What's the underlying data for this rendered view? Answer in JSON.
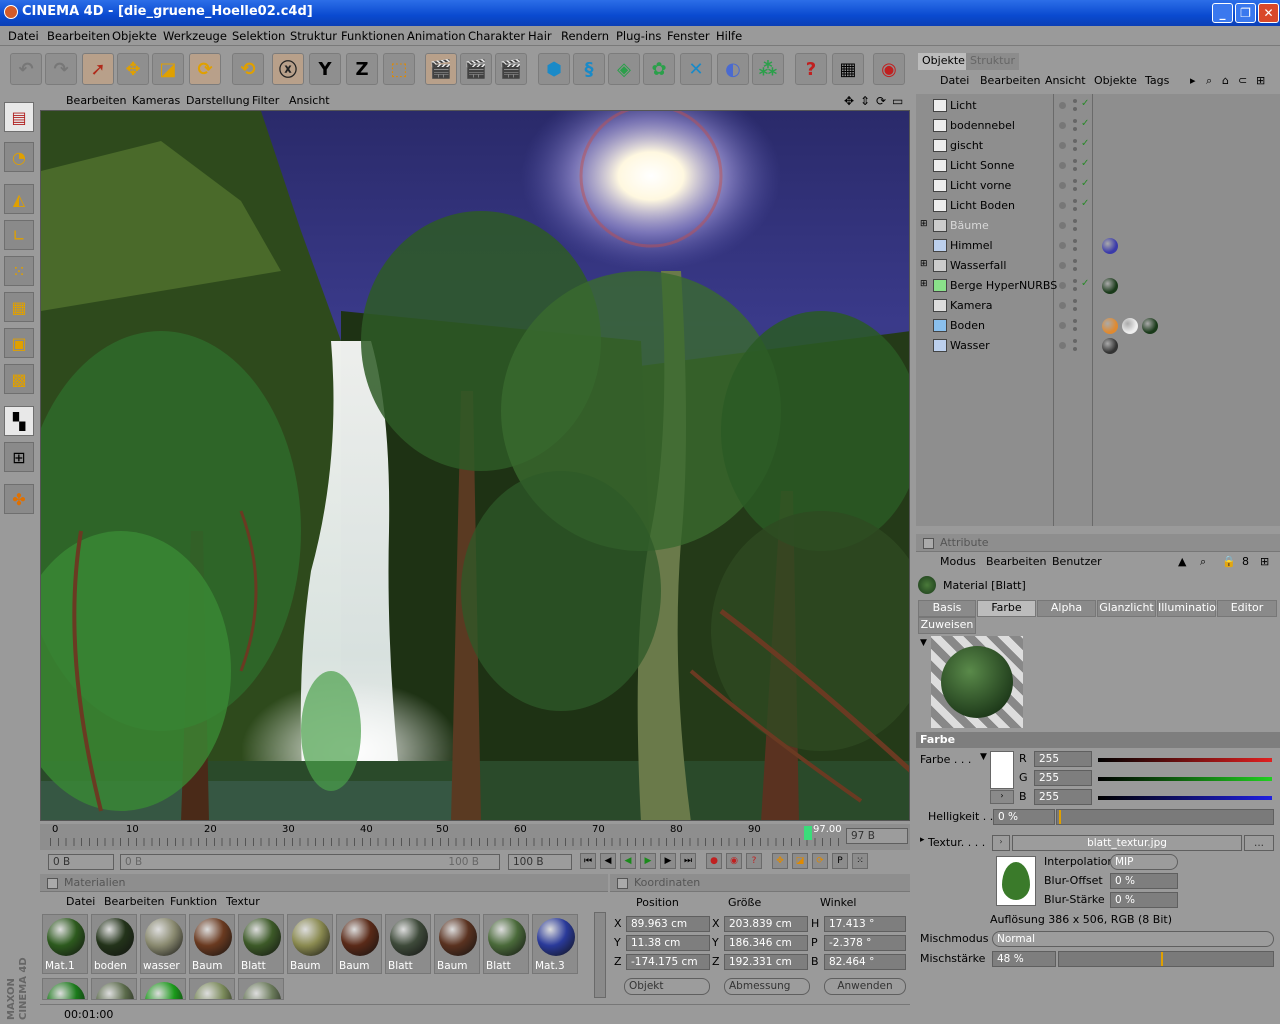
{
  "window": {
    "title": "CINEMA 4D - [die_gruene_Hoelle02.c4d]",
    "min": "_",
    "max": "❐",
    "close": "✕"
  },
  "menubar": [
    "Datei",
    "Bearbeiten",
    "Objekte",
    "Werkzeuge",
    "Selektion",
    "Struktur",
    "Funktionen",
    "Animation",
    "Charakter",
    "Hair",
    "Rendern",
    "Plug-ins",
    "Fenster",
    "Hilfe"
  ],
  "viewport_menu": [
    "Bearbeiten",
    "Kameras",
    "Darstellung",
    "Filter",
    "Ansicht"
  ],
  "timeline": {
    "ticks": [
      "0",
      "10",
      "20",
      "30",
      "40",
      "50",
      "60",
      "70",
      "80",
      "90"
    ],
    "current_marker": "97.00",
    "end_field": "97 B"
  },
  "animbar": {
    "start": "0 B",
    "range_start": "0 B",
    "range_end": "100 B",
    "end": "100 B"
  },
  "materials": {
    "header": "Materialien",
    "menu": [
      "Datei",
      "Bearbeiten",
      "Funktion",
      "Textur"
    ],
    "items": [
      {
        "label": "Mat.1",
        "color": "#2d5a1e"
      },
      {
        "label": "boden",
        "color": "#23331a"
      },
      {
        "label": "wasser",
        "color": "#8a8a70"
      },
      {
        "label": "Baum",
        "color": "#6a3a20"
      },
      {
        "label": "Blatt",
        "color": "#3d5a28"
      },
      {
        "label": "Baum",
        "color": "#8a8a50"
      },
      {
        "label": "Baum",
        "color": "#5a2a18"
      },
      {
        "label": "Blatt",
        "color": "#3e4a3a"
      },
      {
        "label": "Baum",
        "color": "#5a3220"
      },
      {
        "label": "Blatt",
        "color": "#4a6a3a"
      },
      {
        "label": "Mat.3",
        "color": "#2a3a9a"
      }
    ],
    "row2": [
      "#1a7a1a",
      "#5a6a4a",
      "#1a9a1a",
      "#7a8a5a",
      "#6a7a5a"
    ]
  },
  "status": {
    "time": "00:01:00"
  },
  "logo": "MAXON CINEMA 4D",
  "coords": {
    "header": "Koordinaten",
    "cols": [
      "Position",
      "Größe",
      "Winkel"
    ],
    "rows": [
      {
        "a": "X",
        "pos": "89.963 cm",
        "b": "X",
        "size": "203.839 cm",
        "c": "H",
        "ang": "17.413 °"
      },
      {
        "a": "Y",
        "pos": "11.38 cm",
        "b": "Y",
        "size": "186.346 cm",
        "c": "P",
        "ang": "-2.378 °"
      },
      {
        "a": "Z",
        "pos": "-174.175 cm",
        "b": "Z",
        "size": "192.331 cm",
        "c": "B",
        "ang": "82.464 °"
      }
    ],
    "mode": "Objekt",
    "measure": "Abmessung",
    "apply": "Anwenden"
  },
  "objects": {
    "tabs": [
      "Objekte",
      "Struktur"
    ],
    "menu": [
      "Datei",
      "Bearbeiten",
      "Ansicht",
      "Objekte",
      "Tags"
    ],
    "rows": [
      {
        "name": "Licht",
        "dim": false
      },
      {
        "name": "bodennebel",
        "dim": false
      },
      {
        "name": "gischt",
        "dim": false
      },
      {
        "name": "Licht Sonne",
        "dim": false
      },
      {
        "name": "Licht vorne",
        "dim": false
      },
      {
        "name": "Licht Boden",
        "dim": false
      },
      {
        "name": "Bäume",
        "dim": true
      },
      {
        "name": "Himmel",
        "dim": false
      },
      {
        "name": "Wasserfall",
        "dim": false
      },
      {
        "name": "Berge HyperNURBS",
        "dim": false
      },
      {
        "name": "Kamera",
        "dim": false
      },
      {
        "name": "Boden",
        "dim": false
      },
      {
        "name": "Wasser",
        "dim": false
      }
    ]
  },
  "attributes": {
    "header": "Attribute",
    "menu": [
      "Modus",
      "Bearbeiten",
      "Benutzer"
    ],
    "material": "Material [Blatt]",
    "tabs": [
      "Basis",
      "Farbe",
      "Alpha",
      "Glanzlicht",
      "Illumination",
      "Editor"
    ],
    "tab2": "Zuweisen",
    "section": "Farbe",
    "farbe_label": "Farbe . . .",
    "r_label": "R",
    "g_label": "G",
    "b_label": "B",
    "r": "255",
    "g": "255",
    "b": "255",
    "helligkeit_label": "Helligkeit . .",
    "helligkeit": "0 %",
    "textur_label": "Textur. . . .",
    "textur_file": "blatt_textur.jpg",
    "textur_more": "...",
    "interp_label": "Interpolation",
    "interp": "MIP",
    "bluroff_label": "Blur-Offset",
    "bluroff": "0 %",
    "blurst_label": "Blur-Stärke",
    "blurst": "0 %",
    "resolution": "Auflösung 386 x 506, RGB (8 Bit)",
    "mischmodus_label": "Mischmodus",
    "mischmodus": "Normal",
    "mischstaerke_label": "Mischstärke",
    "mischstaerke": "48 %",
    "mischstaerke_value": 0.48
  }
}
